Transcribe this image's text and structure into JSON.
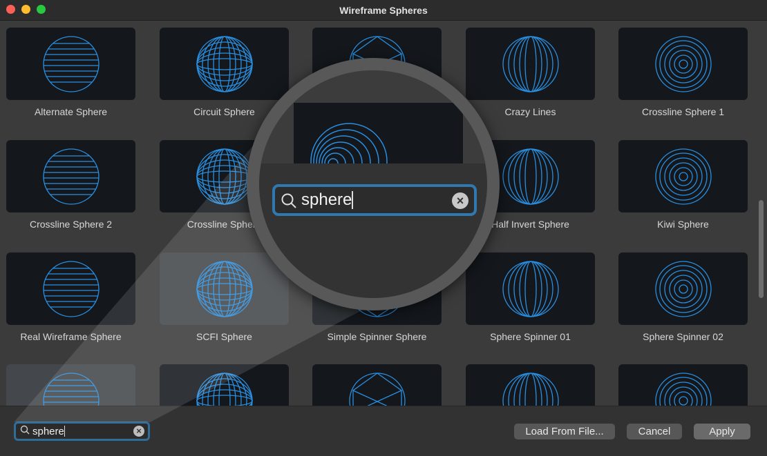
{
  "window": {
    "title": "Wireframe Spheres"
  },
  "tiles": [
    {
      "label": "Alternate Sphere"
    },
    {
      "label": "Circuit Sphere"
    },
    {
      "label": ""
    },
    {
      "label": "Crazy Lines"
    },
    {
      "label": "Crossline Sphere 1"
    },
    {
      "label": "Crossline Sphere 2"
    },
    {
      "label": "Crossline Sphere"
    },
    {
      "label": ""
    },
    {
      "label": "Half Invert Sphere"
    },
    {
      "label": "Kiwi Sphere"
    },
    {
      "label": "Real Wireframe Sphere"
    },
    {
      "label": "SCFI Sphere"
    },
    {
      "label": "Simple Spinner Sphere"
    },
    {
      "label": "Sphere Spinner 01"
    },
    {
      "label": "Sphere Spinner 02"
    },
    {
      "label": ""
    },
    {
      "label": ""
    },
    {
      "label": ""
    },
    {
      "label": ""
    },
    {
      "label": ""
    }
  ],
  "search": {
    "value": "sphere",
    "clear_icon": "clear-icon"
  },
  "buttons": {
    "load": "Load From File...",
    "cancel": "Cancel",
    "apply": "Apply"
  },
  "colors": {
    "accent": "#2f79b0",
    "wire": "#2a8fe0"
  }
}
